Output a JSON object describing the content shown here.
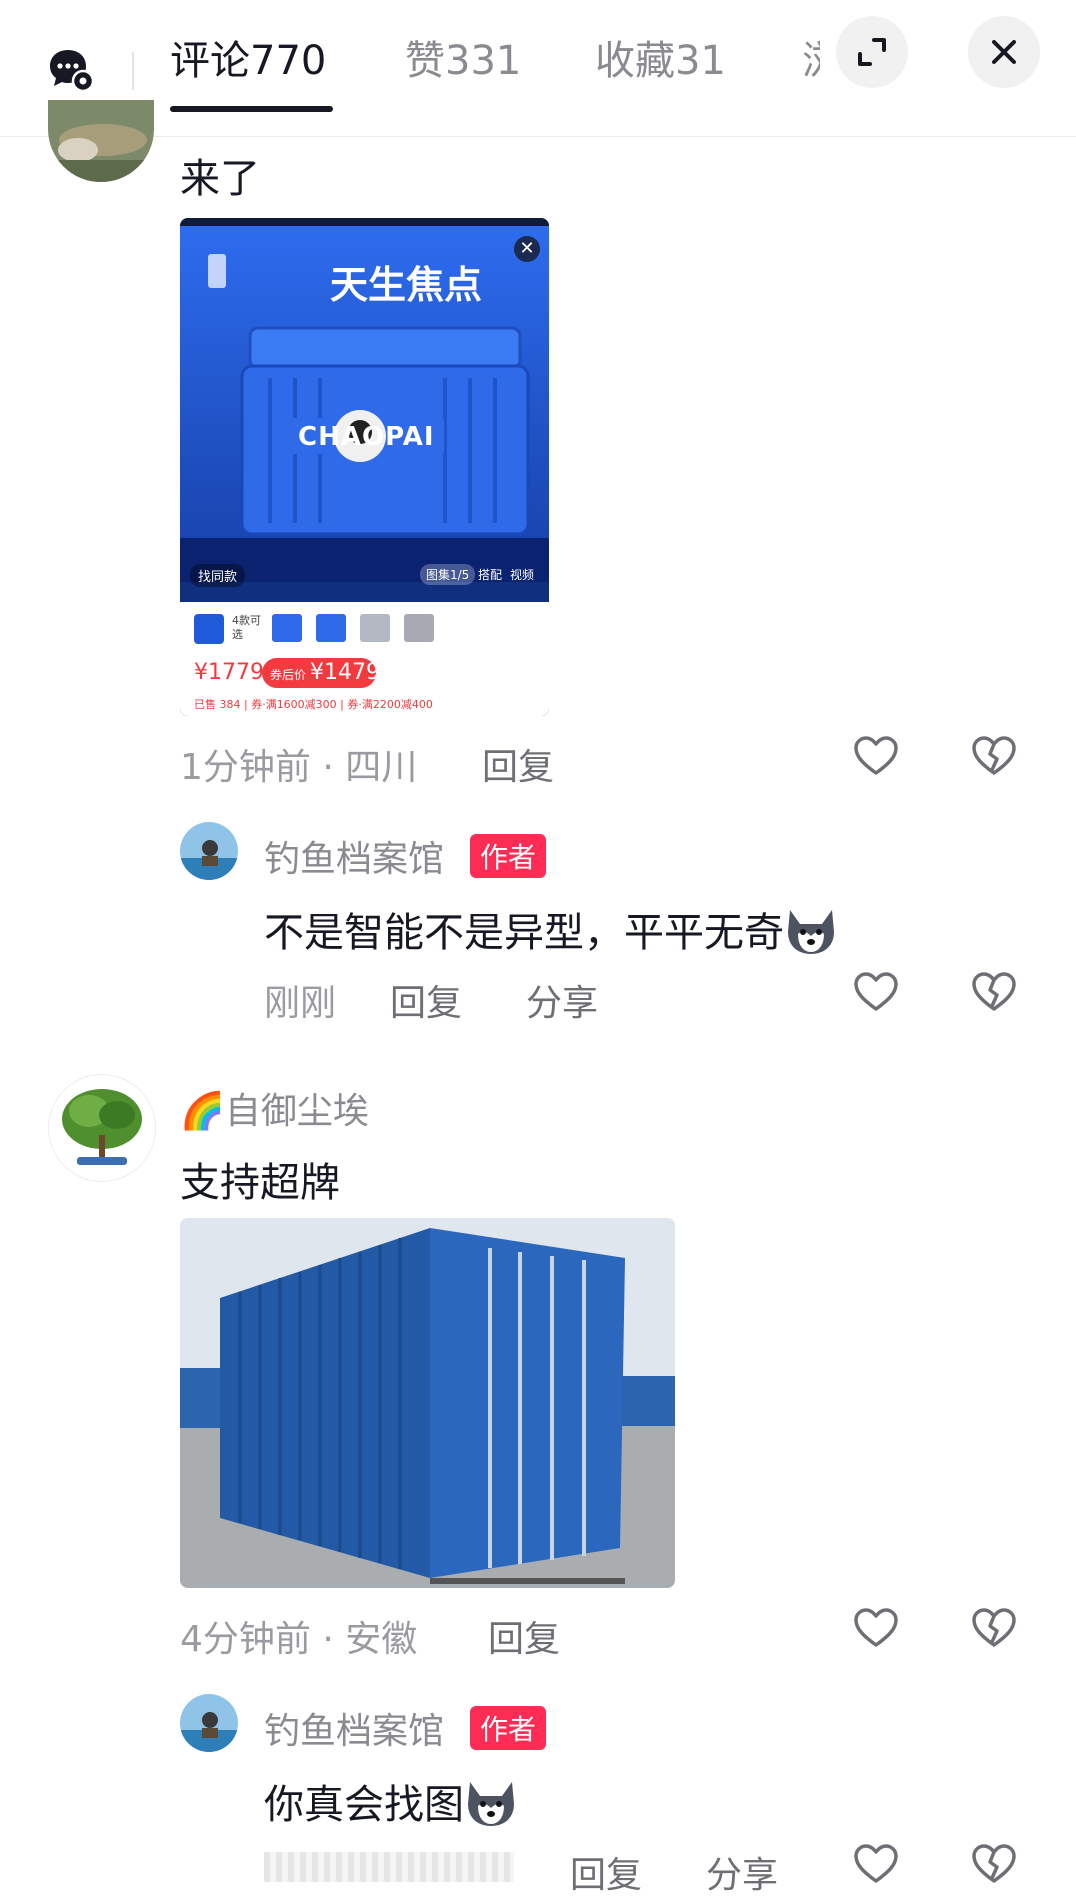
{
  "header": {
    "tabs": [
      {
        "label": "评论770"
      },
      {
        "label": "赞331"
      },
      {
        "label": "收藏31"
      },
      {
        "label": "浏"
      }
    ]
  },
  "comments": [
    {
      "text": "来了",
      "meta": "1分钟前 · 四川",
      "reply_label": "回复",
      "product": {
        "title": "天生焦点",
        "brand_text": "CHAOPAI",
        "find_same": "找同款",
        "gallery": "图集1/5",
        "match": "搭配",
        "video": "视频",
        "options": "4款可选",
        "price": "¥1779",
        "coupon_label": "券后价",
        "coupon_price": "¥1479",
        "sold": "已售 384 | 券·满1600减300 | 券·满2200减400"
      },
      "reply": {
        "username": "钓鱼档案馆",
        "badge": "作者",
        "text": "不是智能不是异型，平平无奇",
        "time": "刚刚",
        "reply_label": "回复",
        "share_label": "分享"
      }
    },
    {
      "username_prefix": "🌈",
      "username": "自御尘埃",
      "text": "支持超牌",
      "meta": "4分钟前 · 安徽",
      "reply_label": "回复",
      "reply": {
        "username": "钓鱼档案馆",
        "badge": "作者",
        "text": "你真会找图",
        "reply_label": "回复",
        "share_label": "分享"
      }
    }
  ],
  "colors": {
    "accent_red": "#fe2c55",
    "text_primary": "#161823",
    "text_secondary": "#8a8b91"
  },
  "icons": [
    "message-settings-icon",
    "expand-icon",
    "close-icon",
    "heart-icon",
    "broken-heart-icon",
    "dog-emoji-icon"
  ]
}
